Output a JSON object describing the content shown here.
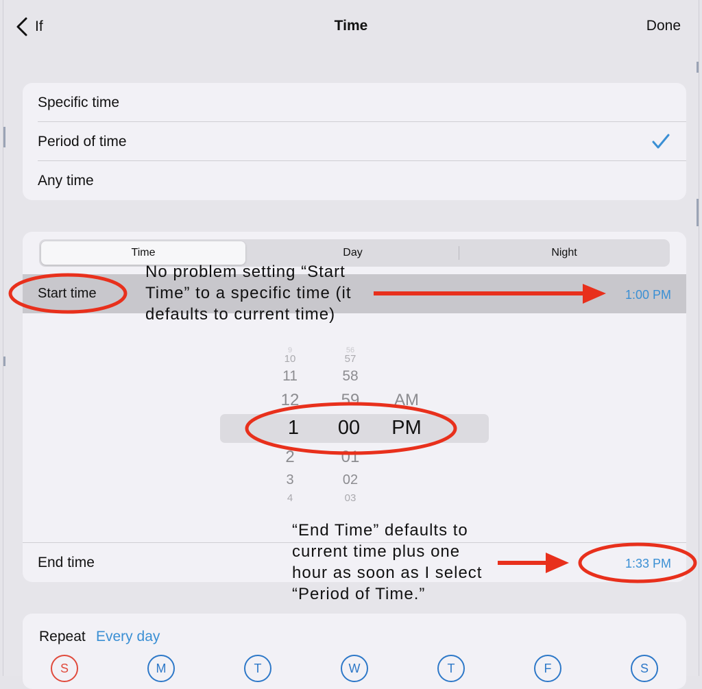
{
  "nav": {
    "back_label": "If",
    "title": "Time",
    "done_label": "Done"
  },
  "time_modes": {
    "items": [
      {
        "label": "Specific time",
        "checked": false
      },
      {
        "label": "Period of time",
        "checked": true
      },
      {
        "label": "Any time",
        "checked": false
      }
    ]
  },
  "segments": {
    "items": [
      "Time",
      "Day",
      "Night"
    ],
    "selected": "Time"
  },
  "start_time": {
    "label": "Start time",
    "value": "1:00 PM"
  },
  "end_time": {
    "label": "End time",
    "value": "1:33 PM"
  },
  "picker": {
    "hours": [
      "9",
      "10",
      "11",
      "12",
      "1",
      "2",
      "3",
      "4"
    ],
    "minutes": [
      "56",
      "57",
      "58",
      "59",
      "00",
      "01",
      "02",
      "03"
    ],
    "periods": [
      "AM",
      "PM"
    ],
    "selected_hour": "1",
    "selected_minute": "00",
    "selected_period": "PM"
  },
  "annotations": {
    "start": [
      "No problem setting “Start",
      "Time” to a specific time (it",
      "defaults to current time)"
    ],
    "end": [
      "“End Time” defaults to",
      "current time plus one",
      "hour as soon as I select",
      "“Period of  Time.”"
    ]
  },
  "repeat": {
    "label": "Repeat",
    "value": "Every day",
    "days": [
      "S",
      "M",
      "T",
      "W",
      "T",
      "F",
      "S"
    ]
  },
  "colors": {
    "accent": "#3a8fd4",
    "annotation": "#e8301c",
    "sunday": "#e04a3c"
  },
  "icons": {
    "back": "chevron-left-icon",
    "check": "checkmark-icon"
  }
}
